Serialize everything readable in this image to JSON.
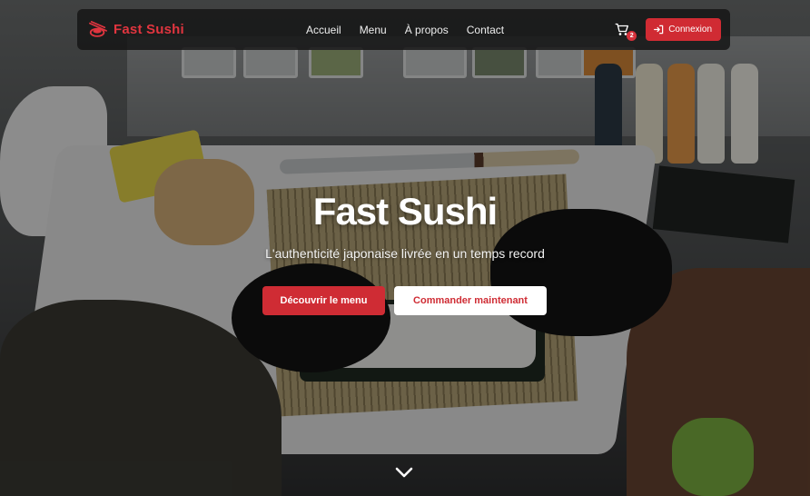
{
  "brand": {
    "name": "Fast Sushi",
    "icon": "sushi-chopsticks-logo-icon",
    "color": "#e0353f"
  },
  "nav": {
    "links": [
      {
        "label": "Accueil"
      },
      {
        "label": "Menu"
      },
      {
        "label": "À propos"
      },
      {
        "label": "Contact"
      }
    ],
    "cart": {
      "icon": "cart-icon",
      "count": "2"
    },
    "login": {
      "label": "Connexion",
      "icon": "sign-in-icon"
    }
  },
  "hero": {
    "title": "Fast Sushi",
    "subtitle": "L'authenticité japonaise livrée en un temps record",
    "primary_cta": "Découvrir le menu",
    "secondary_cta": "Commander maintenant",
    "scroll_icon": "chevron-down-icon",
    "background": "photo-sushi-preparation"
  },
  "colors": {
    "accent": "#d02b33",
    "navbar_bg": "#161616",
    "text_light": "#ffffff"
  }
}
